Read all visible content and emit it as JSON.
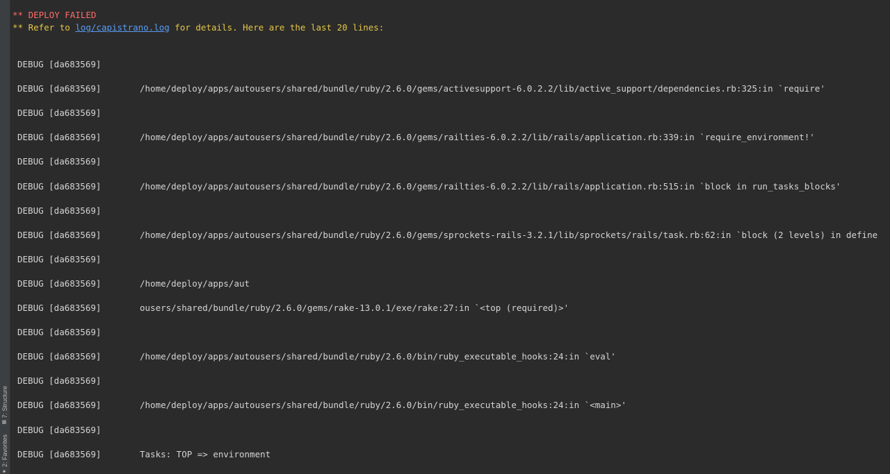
{
  "header": {
    "failed": "** DEPLOY FAILED",
    "refer_prefix": "** Refer to ",
    "refer_link": "log/capistrano.log",
    "refer_suffix": " for details. Here are the last 20 lines:"
  },
  "log": [
    {
      "prefix": "DEBUG [da683569]",
      "message": ""
    },
    {
      "prefix": "DEBUG [da683569]",
      "message": "/home/deploy/apps/autousers/shared/bundle/ruby/2.6.0/gems/activesupport-6.0.2.2/lib/active_support/dependencies.rb:325:in `require'"
    },
    {
      "prefix": "DEBUG [da683569]",
      "message": ""
    },
    {
      "prefix": "DEBUG [da683569]",
      "message": "/home/deploy/apps/autousers/shared/bundle/ruby/2.6.0/gems/railties-6.0.2.2/lib/rails/application.rb:339:in `require_environment!'"
    },
    {
      "prefix": "DEBUG [da683569]",
      "message": ""
    },
    {
      "prefix": "DEBUG [da683569]",
      "message": "/home/deploy/apps/autousers/shared/bundle/ruby/2.6.0/gems/railties-6.0.2.2/lib/rails/application.rb:515:in `block in run_tasks_blocks'"
    },
    {
      "prefix": "DEBUG [da683569]",
      "message": ""
    },
    {
      "prefix": "DEBUG [da683569]",
      "message": "/home/deploy/apps/autousers/shared/bundle/ruby/2.6.0/gems/sprockets-rails-3.2.1/lib/sprockets/rails/task.rb:62:in `block (2 levels) in define"
    },
    {
      "prefix": "DEBUG [da683569]",
      "message": ""
    },
    {
      "prefix": "DEBUG [da683569]",
      "message": "/home/deploy/apps/aut"
    },
    {
      "prefix": "DEBUG [da683569]",
      "message": "ousers/shared/bundle/ruby/2.6.0/gems/rake-13.0.1/exe/rake:27:in `<top (required)>'"
    },
    {
      "prefix": "DEBUG [da683569]",
      "message": ""
    },
    {
      "prefix": "DEBUG [da683569]",
      "message": "/home/deploy/apps/autousers/shared/bundle/ruby/2.6.0/bin/ruby_executable_hooks:24:in `eval'"
    },
    {
      "prefix": "DEBUG [da683569]",
      "message": ""
    },
    {
      "prefix": "DEBUG [da683569]",
      "message": "/home/deploy/apps/autousers/shared/bundle/ruby/2.6.0/bin/ruby_executable_hooks:24:in `<main>'"
    },
    {
      "prefix": "DEBUG [da683569]",
      "message": ""
    },
    {
      "prefix": "DEBUG [da683569]",
      "message": "Tasks: TOP => environment"
    }
  ],
  "sidebar": {
    "structure_label": "7: Structure",
    "favorites_label": "2: Favorites"
  },
  "colors": {
    "background": "#2b2b2b",
    "error": "#ff6b68",
    "warning": "#e5c545",
    "link": "#589df6",
    "text": "#d4d4d4"
  }
}
